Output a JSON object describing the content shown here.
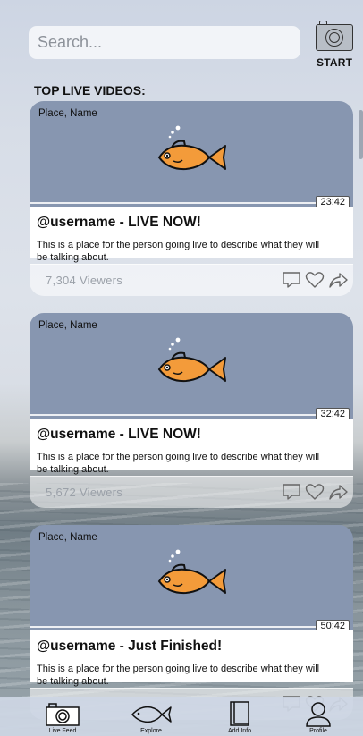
{
  "search": {
    "placeholder": "Search..."
  },
  "start": {
    "label": "START"
  },
  "section_title": "TOP LIVE VIDEOS:",
  "videos": [
    {
      "place": "Place, Name",
      "duration": "23:42",
      "headline": "@username - LIVE NOW!",
      "description": "This is a place for the person going live to describe what they will be talking about.",
      "viewers": "7,304 Viewers"
    },
    {
      "place": "Place, Name",
      "duration": "32:42",
      "headline": "@username - LIVE NOW!",
      "description": "This is a place for the person going live to describe what they will be talking about.",
      "viewers": "5,672 Viewers"
    },
    {
      "place": "Place, Name",
      "duration": "50:42",
      "headline": "@username - Just Finished!",
      "description": "This is a place for the person going live to describe what they will be talking about.",
      "viewers": ""
    }
  ],
  "nav": {
    "items": [
      {
        "label": "Live Feed",
        "icon": "camera-icon"
      },
      {
        "label": "Explore",
        "icon": "fish-icon"
      },
      {
        "label": "Add Info",
        "icon": "pages-icon"
      },
      {
        "label": "Profile",
        "icon": "person-icon"
      }
    ]
  },
  "colors": {
    "video_bg": "#8796b0",
    "fish_orange": "#f39b3a",
    "nav_bg": "#cdd6e4"
  }
}
